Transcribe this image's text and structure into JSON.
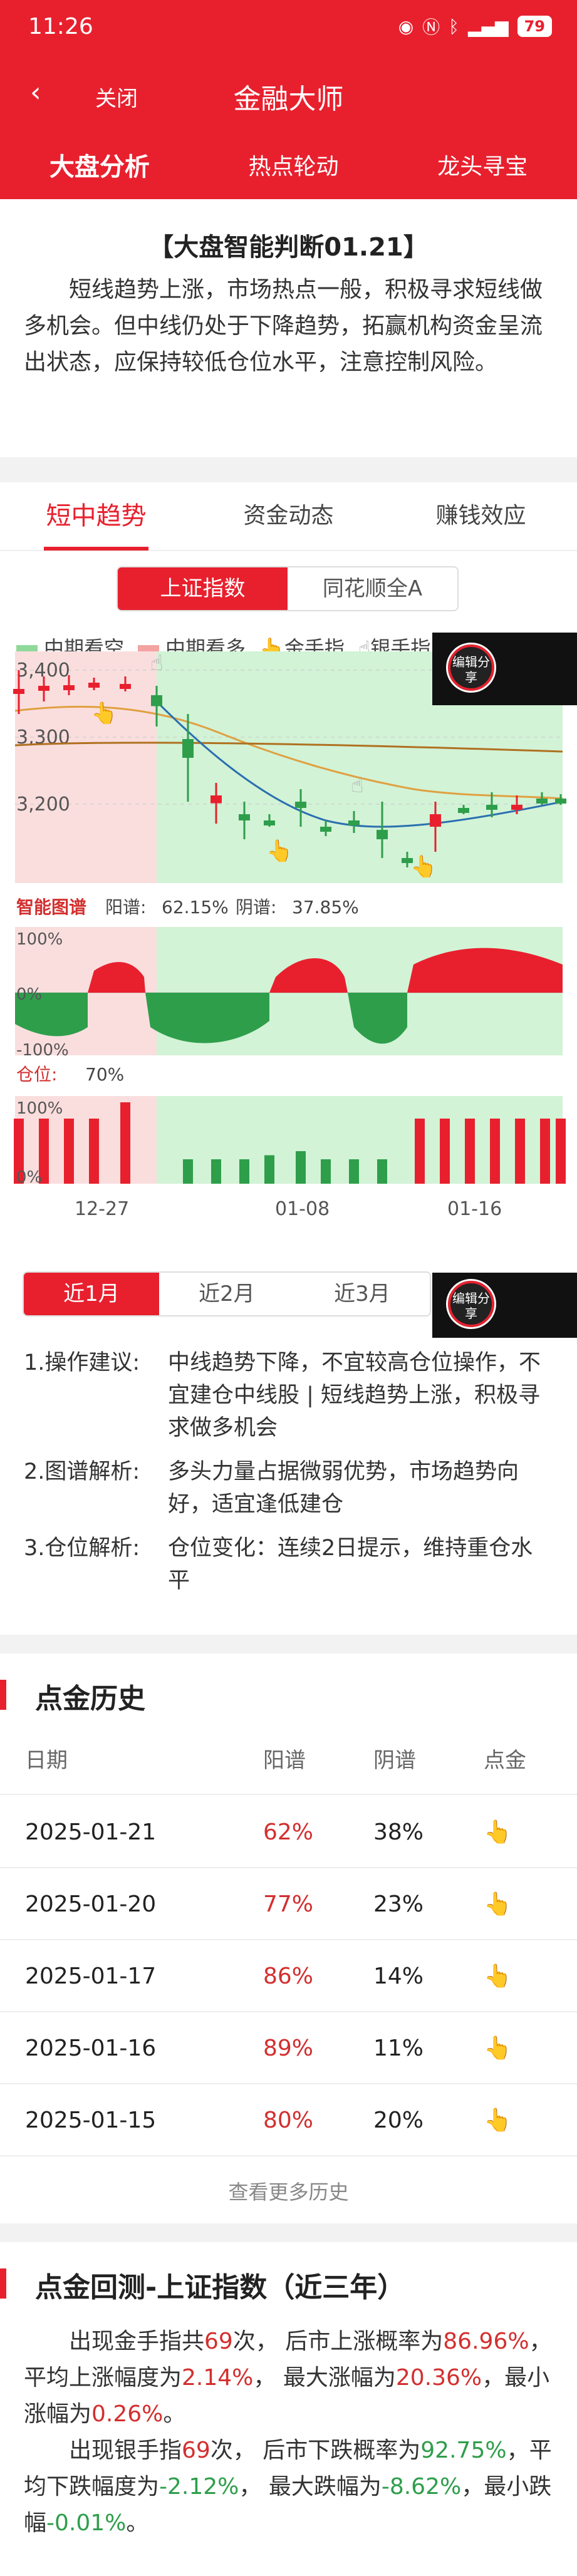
{
  "status": {
    "time": "11:26",
    "battery": "79"
  },
  "nav": {
    "close": "关闭",
    "title": "金融大师"
  },
  "top_tabs": [
    "大盘分析",
    "热点轮动",
    "龙头寻宝"
  ],
  "judge": {
    "title": "【大盘智能判断01.21】",
    "text": "短线趋势上涨，市场热点一般，积极寻求短线做多机会。但中线仍处于下降趋势，拓赢机构资金呈流出状态，应保持较低仓位水平，注意控制风险。"
  },
  "tabs2": [
    "短中趋势",
    "资金动态",
    "赚钱效应"
  ],
  "index_tabs": [
    "上证指数",
    "同花顺全A"
  ],
  "legend": [
    "中期看空",
    "中期看多",
    "金手指",
    "银手指"
  ],
  "edit_share": "编辑分享",
  "chart_data": {
    "type": "candlestick",
    "y_ticks": [
      "3,400",
      "3,300",
      "3,200"
    ],
    "x_ticks": [
      "12-27",
      "01-08",
      "01-16"
    ],
    "smart_label": "智能图谱",
    "yang_label": "阳谱:",
    "yang_value": "62.15%",
    "yin_label": "阴谱:",
    "yin_value": "37.85%",
    "osc_ticks": [
      "100%",
      "0%",
      "-100%"
    ],
    "position_label": "仓位:",
    "position_value": "70%",
    "pos_ticks": [
      "100%",
      "0%"
    ]
  },
  "periods": [
    "近1月",
    "近2月",
    "近3月"
  ],
  "analysis": [
    {
      "label": "1.操作建议:",
      "value": "中线趋势下降，不宜较高仓位操作，不宜建仓中线股 | 短线趋势上涨，积极寻求做多机会"
    },
    {
      "label": "2.图谱解析:",
      "value": "多头力量占据微弱优势，市场趋势向好，适宜逢低建仓"
    },
    {
      "label": "3.仓位解析:",
      "value": "仓位变化：连续2日提示，维持重仓水平"
    }
  ],
  "history": {
    "title": "点金历史",
    "headers": [
      "日期",
      "阳谱",
      "阴谱",
      "点金"
    ],
    "rows": [
      {
        "date": "2025-01-21",
        "yang": "62%",
        "yin": "38%"
      },
      {
        "date": "2025-01-20",
        "yang": "77%",
        "yin": "23%"
      },
      {
        "date": "2025-01-17",
        "yang": "86%",
        "yin": "14%"
      },
      {
        "date": "2025-01-16",
        "yang": "89%",
        "yin": "11%"
      },
      {
        "date": "2025-01-15",
        "yang": "80%",
        "yin": "20%"
      }
    ],
    "more": "查看更多历史"
  },
  "backtest": {
    "title": "点金回测-上证指数（近三年）",
    "p1": [
      "出现金手指共",
      "69",
      "次， 后市上涨概率为",
      "86.96%",
      "，平均上涨幅度为",
      "2.14%",
      "， 最大涨幅为",
      "20.36%",
      "，最小涨幅为",
      "0.26%",
      "。"
    ],
    "p2": [
      "出现银手指",
      "69",
      "次， 后市下跌概率为",
      "92.75%",
      "，平均下跌幅度为",
      "-2.12%",
      "， 最大跌幅为",
      "-8.62%",
      "，最小跌幅",
      "-0.01%",
      "。"
    ]
  }
}
